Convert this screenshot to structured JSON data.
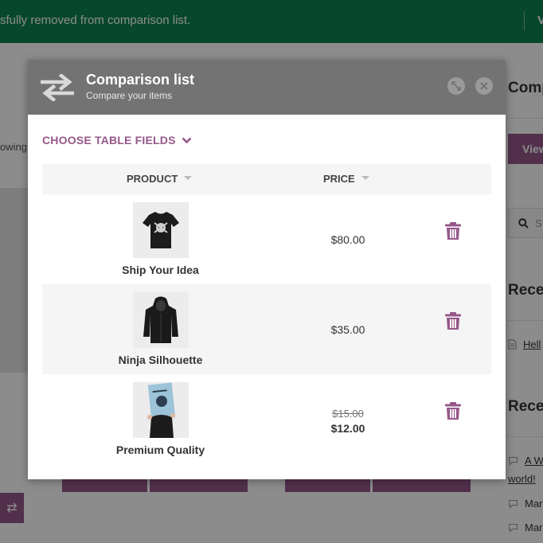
{
  "notice": {
    "text": "sfully removed from comparison list.",
    "action_partial": "V"
  },
  "background": {
    "left_showing_text": "owing",
    "sidebar": {
      "heading_top": "Comp",
      "view_button": "View",
      "search_placeholder": "S",
      "recent_posts_heading": "Recen",
      "recent_post_link": "Hell",
      "recent_comments_heading": "Recen",
      "comment_link_1": "A W",
      "comment_link_1_cont": "world!",
      "comment_2": "Mar",
      "comment_3": "Mar"
    }
  },
  "modal": {
    "title": "Comparison list",
    "subtitle": "Compare your items",
    "choose_fields_label": "CHOOSE TABLE FIELDS",
    "columns": {
      "product": "PRODUCT",
      "price": "PRICE"
    },
    "products": [
      {
        "name": "Ship Your Idea",
        "price": "$80.00",
        "image": "black-tshirt-skull"
      },
      {
        "name": "Ninja Silhouette",
        "price": "$35.00",
        "image": "black-hoodie"
      },
      {
        "name": "Premium Quality",
        "price_old": "$15.00",
        "price_new": "$12.00",
        "image": "poster"
      }
    ]
  },
  "colors": {
    "notice_bg": "#0f834d",
    "accent": "#96588a",
    "modal_header_bg": "#737373"
  },
  "icons": {
    "compare": "swap-arrows-icon",
    "expand": "expand-icon",
    "close": "close-icon",
    "chevron": "chevron-down-icon",
    "remove": "trash-icon",
    "search": "search-icon",
    "post": "document-icon",
    "comment": "comment-icon"
  }
}
